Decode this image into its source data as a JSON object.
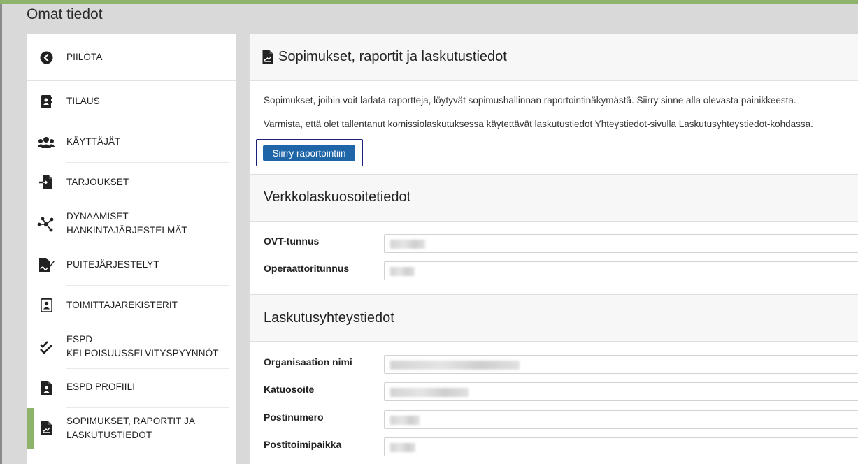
{
  "page": {
    "title": "Omat tiedot"
  },
  "sidebar": {
    "hide_label": "PIILOTA",
    "items": [
      {
        "label": "TILAUS",
        "icon": "address-book-icon"
      },
      {
        "label": "KÄYTTÄJÄT",
        "icon": "users-icon"
      },
      {
        "label": "TARJOUKSET",
        "icon": "file-import-icon"
      },
      {
        "label": "DYNAAMISET\nHANKINTAJÄRJESTELMÄT",
        "icon": "network-icon"
      },
      {
        "label": "PUITEJÄRJESTELYT",
        "icon": "file-signature-icon"
      },
      {
        "label": "TOIMITTAJAREKISTERIT",
        "icon": "id-card-icon"
      },
      {
        "label": "ESPD-\nKELPOISUUSSELVITYSPYYNNÖT",
        "icon": "double-check-icon"
      },
      {
        "label": "ESPD PROFIILI",
        "icon": "user-file-icon"
      },
      {
        "label": "SOPIMUKSET, RAPORTIT JA\nLASKUTUSTIEDOT",
        "icon": "file-chart-icon",
        "active": true
      }
    ]
  },
  "main": {
    "title": "Sopimukset, raportit ja laskutustiedot",
    "intro1": "Sopimukset, joihin voit ladata raportteja, löytyvät sopimushallinnan raportointinäkymästä. Siirry sinne alla olevasta painikkeesta.",
    "intro2": "Varmista, että olet tallentanut komissiolaskutuksessa käytettävät laskutustiedot Yhteystiedot-sivulla Laskutusyhteystiedot-kohdassa.",
    "report_button": "Siirry raportointiin",
    "einvoice": {
      "heading": "Verkkolaskuosoitetiedot",
      "ovt_label": "OVT-tunnus",
      "operator_label": "Operaattoritunnus"
    },
    "billing": {
      "heading": "Laskutusyhteystiedot",
      "org_label": "Organisaation nimi",
      "street_label": "Katuosoite",
      "postal_label": "Postinumero",
      "city_label": "Postitoimipaikka"
    }
  },
  "colors": {
    "accent": "#8db46a",
    "button": "#1f66a9",
    "focus": "#1c1f7a"
  }
}
